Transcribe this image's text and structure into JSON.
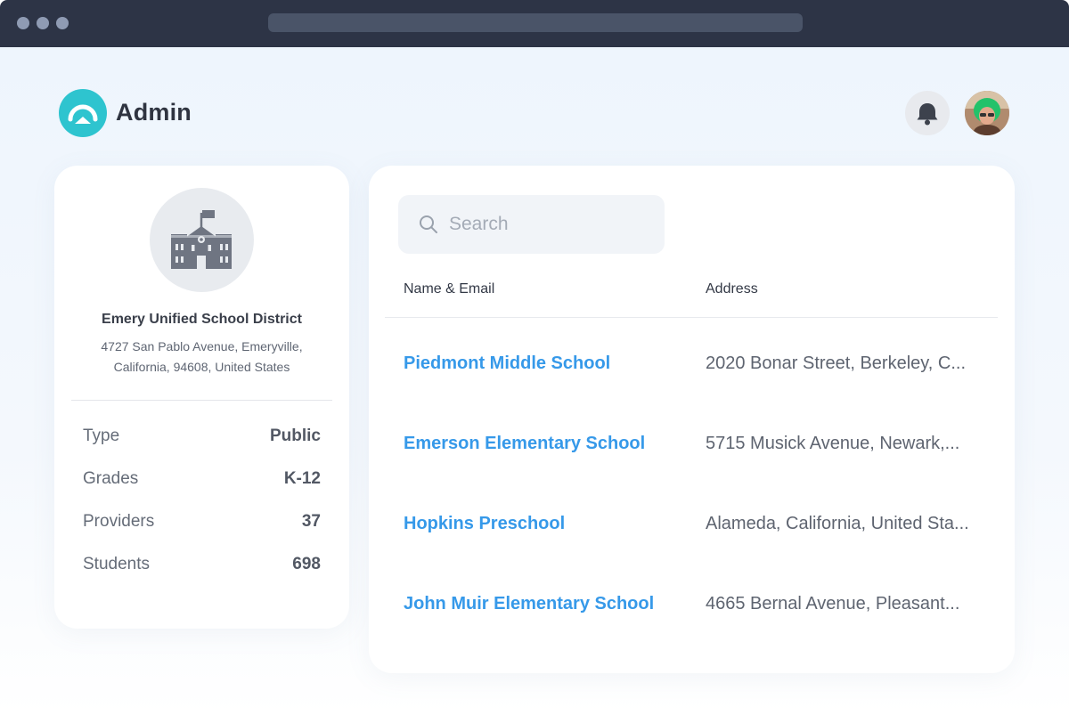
{
  "app": {
    "title": "Admin",
    "accent_color": "#2ec4cf",
    "link_color": "#3699e9"
  },
  "header": {
    "notification_icon": "bell-icon",
    "avatar_icon": "user-avatar"
  },
  "district": {
    "icon": "school-building-icon",
    "name": "Emery Unified School District",
    "address_line1": "4727 San Pablo Avenue, Emeryville,",
    "address_line2": "California, 94608, United States",
    "stats": [
      {
        "label": "Type",
        "value": "Public"
      },
      {
        "label": "Grades",
        "value": "K-12"
      },
      {
        "label": "Providers",
        "value": "37"
      },
      {
        "label": "Students",
        "value": "698"
      }
    ]
  },
  "search": {
    "placeholder": "Search",
    "value": ""
  },
  "table": {
    "columns": [
      "Name & Email",
      "Address"
    ],
    "rows": [
      {
        "name": "Piedmont Middle School",
        "address": "2020 Bonar Street, Berkeley, C..."
      },
      {
        "name": "Emerson Elementary School",
        "address": "5715 Musick Avenue,  Newark,..."
      },
      {
        "name": "Hopkins Preschool",
        "address": "Alameda, California, United Sta..."
      },
      {
        "name": "John Muir Elementary School",
        "address": "4665 Bernal Avenue, Pleasant..."
      }
    ]
  }
}
